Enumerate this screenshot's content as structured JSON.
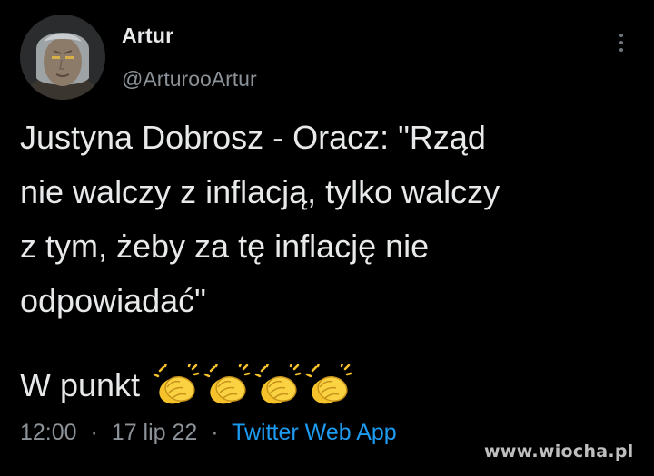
{
  "tweet": {
    "author": {
      "name": "Artur",
      "handle": "@ArturooArtur"
    },
    "text": "Justyna Dobrosz - Oracz: \"Rząd\nnie walczy z inflacją, tylko walczy\nz tym, żeby za tę inflację nie\nodpowiadać\"",
    "closing_text": "W punkt",
    "emoji": [
      "clapping-hands",
      "clapping-hands",
      "clapping-hands",
      "clapping-hands"
    ],
    "time": "12:00",
    "date": "17 lip 22",
    "separator": "·",
    "source": "Twitter Web App"
  },
  "watermark": "www.wiocha.pl",
  "colors": {
    "background": "#000000",
    "text": "#e7e9ea",
    "secondary": "#8b9298",
    "link": "#1d9bf0",
    "emoji": "#f6c22b"
  }
}
